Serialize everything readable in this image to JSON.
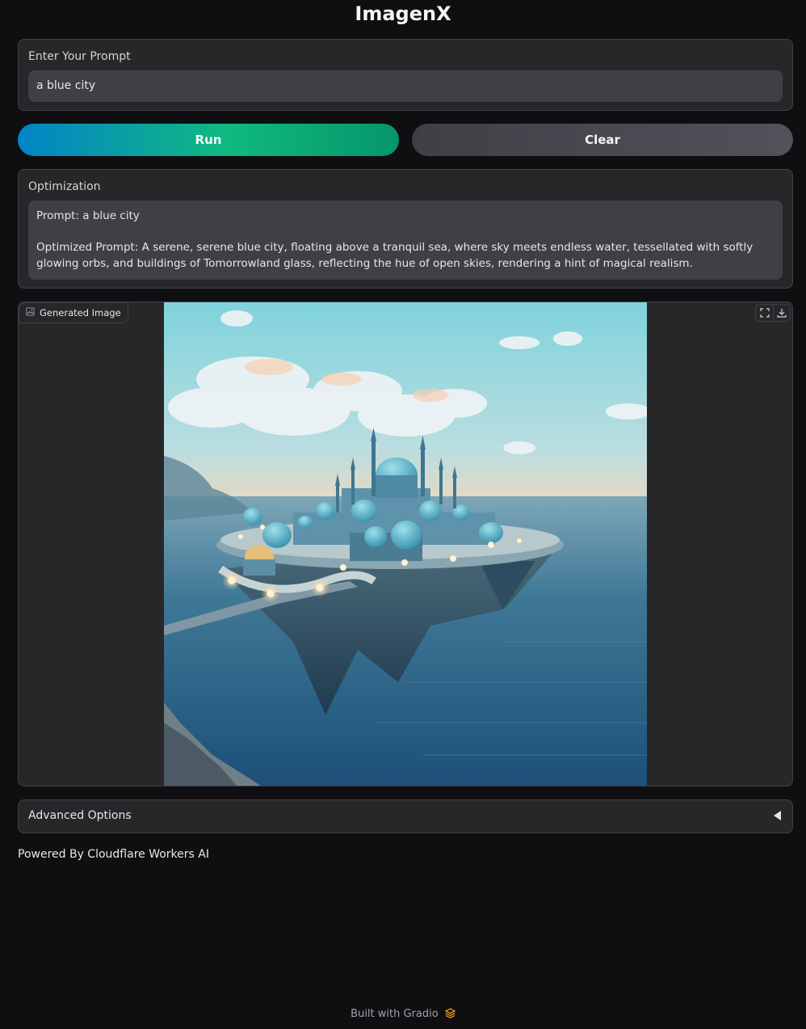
{
  "app": {
    "title": "ImagenX"
  },
  "prompt": {
    "label": "Enter Your Prompt",
    "value": "a blue city"
  },
  "buttons": {
    "run": "Run",
    "clear": "Clear"
  },
  "optimization": {
    "label": "Optimization",
    "prompt_line": "Prompt: a blue city",
    "optimized_line": "Optimized Prompt: A serene, serene blue city, floating above a tranquil sea, where sky meets endless water, tessellated with softly glowing orbs, and buildings of Tomorrowland glass, reflecting the hue of open skies, rendering a hint of magical realism."
  },
  "image_panel": {
    "label": "Generated Image",
    "icons": [
      "image-icon",
      "fullscreen-icon",
      "download-icon"
    ]
  },
  "advanced": {
    "label": "Advanced Options"
  },
  "powered_by": "Powered By Cloudflare Workers AI",
  "footer": {
    "text": "Built with Gradio"
  },
  "colors": {
    "background": "#0f0f11",
    "panel": "#27272a",
    "field": "#3f3f46",
    "run_gradient_start": "#0284c7",
    "run_gradient_end": "#10b981",
    "gradio_logo": "#f59e0b"
  }
}
